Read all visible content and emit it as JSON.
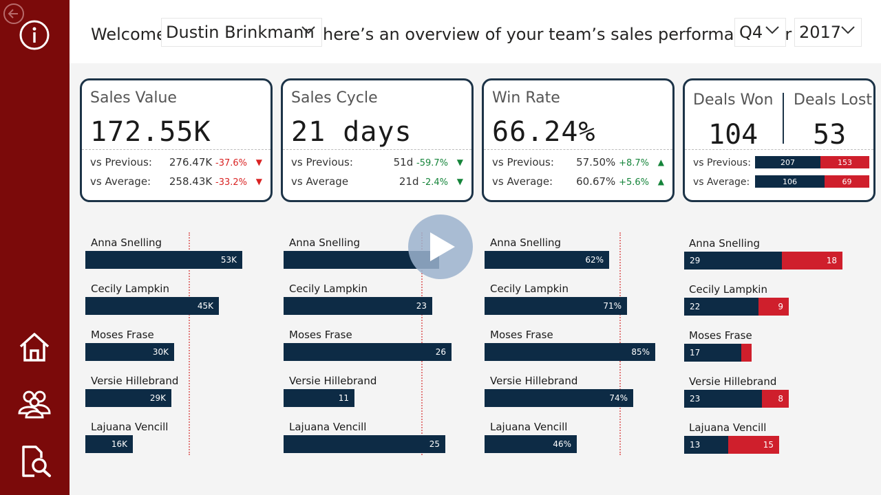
{
  "header": {
    "welcome": "Welcome",
    "user": "Dustin Brinkmann",
    "overview": "here’s an overview of your team’s sales performance for",
    "quarter": "Q4",
    "year": "2017"
  },
  "cards": {
    "sales_value": {
      "title": "Sales Value",
      "value": "172.55K",
      "prev_label": "vs Previous:",
      "prev_value": "276.47K",
      "prev_pct": "-37.6%",
      "avg_label": "vs Average:",
      "avg_value": "258.43K",
      "avg_pct": "-33.2%"
    },
    "sales_cycle": {
      "title": "Sales Cycle",
      "value": "21 days",
      "prev_label": "vs Previous:",
      "prev_value": "51d",
      "prev_pct": "-59.7%",
      "avg_label": "vs Average",
      "avg_value": "21d",
      "avg_pct": "-2.4%"
    },
    "win_rate": {
      "title": "Win Rate",
      "value": "66.24%",
      "prev_label": "vs Previous:",
      "prev_value": "57.50%",
      "prev_pct": "+8.7%",
      "avg_label": "vs Average:",
      "avg_value": "60.67%",
      "avg_pct": "+5.6%"
    },
    "deals": {
      "won_title": "Deals Won",
      "won_value": "104",
      "lost_title": "Deals Lost",
      "lost_value": "53",
      "prev_label": "vs Previous:",
      "prev_won": "207",
      "prev_lost": "153",
      "avg_label": "vs Average:",
      "avg_won": "106",
      "avg_lost": "69"
    }
  },
  "colors": {
    "accent": "#7b0a0a",
    "navy": "#0d2b45",
    "red": "#cf1f2c",
    "positive": "#15843a",
    "negative": "#d92323"
  },
  "chart_data": [
    {
      "type": "bar",
      "categories": [
        "Anna Snelling",
        "Cecily Lampkin",
        "Moses Frase",
        "Versie Hillebrand",
        "Lajuana Vencill"
      ],
      "values": [
        53,
        45,
        30,
        29,
        16
      ],
      "labels": [
        "53K",
        "45K",
        "30K",
        "29K",
        "16K"
      ]
    },
    {
      "type": "bar",
      "categories": [
        "Anna Snelling",
        "Cecily Lampkin",
        "Moses Frase",
        "Versie Hillebrand",
        "Lajuana Vencill"
      ],
      "values": [
        24,
        23,
        26,
        11,
        25
      ],
      "labels": [
        "",
        "23",
        "26",
        "11",
        "25"
      ]
    },
    {
      "type": "bar",
      "categories": [
        "Anna Snelling",
        "Cecily Lampkin",
        "Moses Frase",
        "Versie Hillebrand",
        "Lajuana Vencill"
      ],
      "values": [
        62,
        71,
        85,
        74,
        46
      ],
      "labels": [
        "62%",
        "71%",
        "85%",
        "74%",
        "46%"
      ]
    },
    {
      "type": "bar",
      "categories": [
        "Anna Snelling",
        "Cecily Lampkin",
        "Moses Frase",
        "Versie Hillebrand",
        "Lajuana Vencill"
      ],
      "series": [
        {
          "name": "Deals Won",
          "values": [
            29,
            22,
            17,
            23,
            13
          ]
        },
        {
          "name": "Deals Lost",
          "values": [
            18,
            9,
            3,
            8,
            15
          ]
        }
      ],
      "labels_won": [
        "29",
        "22",
        "17",
        "23",
        "13"
      ],
      "labels_lost": [
        "18",
        "9",
        "",
        "8",
        "15"
      ]
    }
  ],
  "sidebar": {
    "icons": [
      "info-icon",
      "home-icon",
      "people-icon",
      "document-search-icon"
    ]
  }
}
